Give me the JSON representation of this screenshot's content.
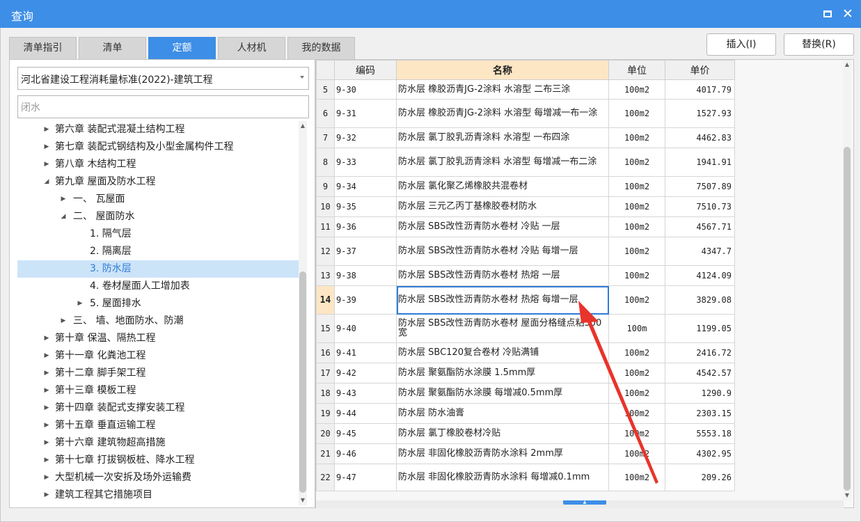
{
  "window": {
    "title": "查询"
  },
  "tabs": [
    {
      "label": "清单指引",
      "active": false
    },
    {
      "label": "清单",
      "active": false
    },
    {
      "label": "定额",
      "active": true
    },
    {
      "label": "人材机",
      "active": false
    },
    {
      "label": "我的数据",
      "active": false
    }
  ],
  "actions": {
    "insert": "插入(I)",
    "replace": "替换(R)"
  },
  "filter": {
    "standard": "河北省建设工程消耗量标准(2022)-建筑工程",
    "keyword": "闭水"
  },
  "tree": [
    {
      "label": "第六章 装配式混凝土结构工程",
      "level": 0,
      "toggle": "collapsed"
    },
    {
      "label": "第七章 装配式钢结构及小型金属构件工程",
      "level": 0,
      "toggle": "collapsed"
    },
    {
      "label": "第八章 木结构工程",
      "level": 0,
      "toggle": "collapsed"
    },
    {
      "label": "第九章 屋面及防水工程",
      "level": 0,
      "toggle": "expanded"
    },
    {
      "label": "一、 瓦屋面",
      "level": 1,
      "toggle": "collapsed"
    },
    {
      "label": "二、 屋面防水",
      "level": 1,
      "toggle": "expanded"
    },
    {
      "label": "1. 隔气层",
      "level": 2,
      "toggle": "none"
    },
    {
      "label": "2. 隔离层",
      "level": 2,
      "toggle": "none"
    },
    {
      "label": "3. 防水层",
      "level": 2,
      "toggle": "none",
      "selected": true
    },
    {
      "label": "4. 卷材屋面人工增加表",
      "level": 2,
      "toggle": "none"
    },
    {
      "label": "5. 屋面排水",
      "level": 2,
      "toggle": "collapsed"
    },
    {
      "label": "三、 墙、地面防水、防潮",
      "level": 1,
      "toggle": "collapsed"
    },
    {
      "label": "第十章 保温、隔热工程",
      "level": 0,
      "toggle": "collapsed"
    },
    {
      "label": "第十一章 化粪池工程",
      "level": 0,
      "toggle": "collapsed"
    },
    {
      "label": "第十二章 脚手架工程",
      "level": 0,
      "toggle": "collapsed"
    },
    {
      "label": "第十三章 模板工程",
      "level": 0,
      "toggle": "collapsed"
    },
    {
      "label": "第十四章 装配式支撑安装工程",
      "level": 0,
      "toggle": "collapsed"
    },
    {
      "label": "第十五章 垂直运输工程",
      "level": 0,
      "toggle": "collapsed"
    },
    {
      "label": "第十六章 建筑物超高措施",
      "level": 0,
      "toggle": "collapsed"
    },
    {
      "label": "第十七章 打拔钢板桩、降水工程",
      "level": 0,
      "toggle": "collapsed"
    },
    {
      "label": "大型机械一次安拆及场外运输费",
      "level": 0,
      "toggle": "collapsed"
    },
    {
      "label": "建筑工程其它措施项目",
      "level": 0,
      "toggle": "collapsed"
    }
  ],
  "table": {
    "columns": [
      "编码",
      "名称",
      "单位",
      "单价"
    ],
    "current_row": "14",
    "rows": [
      {
        "no": "5",
        "code": "9-30",
        "name": "防水层 橡胶沥青JG-2涂料 水溶型 二布三涂",
        "unit": "100m2",
        "price": "4017.79"
      },
      {
        "no": "6",
        "code": "9-31",
        "name": "防水层 橡胶沥青JG-2涂料 水溶型 每增减一布一涂",
        "unit": "100m2",
        "price": "1527.93"
      },
      {
        "no": "7",
        "code": "9-32",
        "name": "防水层 氯丁胶乳沥青涂料 水溶型 一布四涂",
        "unit": "100m2",
        "price": "4462.83"
      },
      {
        "no": "8",
        "code": "9-33",
        "name": "防水层 氯丁胶乳沥青涂料 水溶型 每增减一布二涂",
        "unit": "100m2",
        "price": "1941.91"
      },
      {
        "no": "9",
        "code": "9-34",
        "name": "防水层 氯化聚乙烯橡胶共混卷材",
        "unit": "100m2",
        "price": "7507.89"
      },
      {
        "no": "10",
        "code": "9-35",
        "name": "防水层 三元乙丙丁基橡胶卷材防水",
        "unit": "100m2",
        "price": "7510.73"
      },
      {
        "no": "11",
        "code": "9-36",
        "name": "防水层 SBS改性沥青防水卷材 冷贴 一层",
        "unit": "100m2",
        "price": "4567.71"
      },
      {
        "no": "12",
        "code": "9-37",
        "name": "防水层 SBS改性沥青防水卷材 冷贴 每增一层",
        "unit": "100m2",
        "price": "4347.7"
      },
      {
        "no": "13",
        "code": "9-38",
        "name": "防水层 SBS改性沥青防水卷材 热熔 一层",
        "unit": "100m2",
        "price": "4124.09"
      },
      {
        "no": "14",
        "code": "9-39",
        "name": "防水层 SBS改性沥青防水卷材 热熔 每增一层",
        "unit": "100m2",
        "price": "3829.08"
      },
      {
        "no": "15",
        "code": "9-40",
        "name": "防水层 SBS改性沥青防水卷材 屋面分格缝点粘300宽",
        "unit": "100m",
        "price": "1199.05"
      },
      {
        "no": "16",
        "code": "9-41",
        "name": "防水层 SBC120复合卷材 冷贴满铺",
        "unit": "100m2",
        "price": "2416.72"
      },
      {
        "no": "17",
        "code": "9-42",
        "name": "防水层 聚氨酯防水涂膜 1.5mm厚",
        "unit": "100m2",
        "price": "4542.57"
      },
      {
        "no": "18",
        "code": "9-43",
        "name": "防水层 聚氨酯防水涂膜 每增减0.5mm厚",
        "unit": "100m2",
        "price": "1290.9"
      },
      {
        "no": "19",
        "code": "9-44",
        "name": "防水层 防水油膏",
        "unit": "100m2",
        "price": "2303.15"
      },
      {
        "no": "20",
        "code": "9-45",
        "name": "防水层 氯丁橡胶卷材冷贴",
        "unit": "100m2",
        "price": "5553.18"
      },
      {
        "no": "21",
        "code": "9-46",
        "name": "防水层 非固化橡胶沥青防水涂料 2mm厚",
        "unit": "100m2",
        "price": "4302.95"
      },
      {
        "no": "22",
        "code": "9-47",
        "name": "防水层 非固化橡胶沥青防水涂料 每增减0.1mm",
        "unit": "100m2",
        "price": "209.26"
      }
    ]
  },
  "icons": {
    "maximize": "maximize-icon",
    "close": "close-icon",
    "caret": "chevron-down-icon",
    "annotation": "red-arrow-annotation"
  },
  "colors": {
    "titlebar": "#3d8ee6",
    "active_tab": "#3d8ee6",
    "selected_tree": "#cce4f8",
    "header_highlight": "#fde6c4",
    "annotation": "#e8342b"
  }
}
